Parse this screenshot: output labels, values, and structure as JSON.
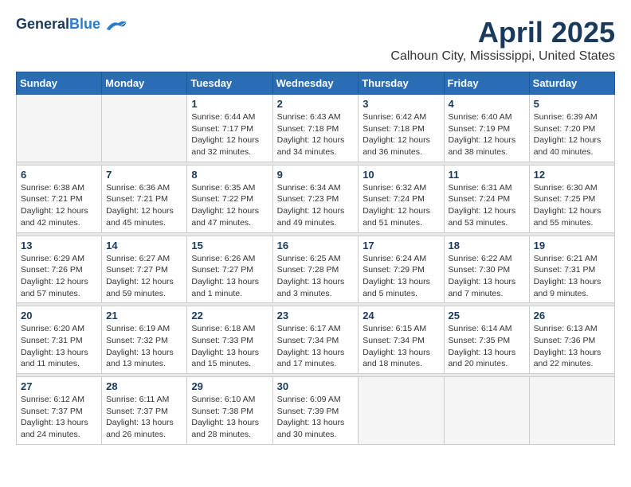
{
  "logo": {
    "general": "General",
    "blue": "Blue"
  },
  "title": "April 2025",
  "subtitle": "Calhoun City, Mississippi, United States",
  "headers": [
    "Sunday",
    "Monday",
    "Tuesday",
    "Wednesday",
    "Thursday",
    "Friday",
    "Saturday"
  ],
  "weeks": [
    [
      {
        "num": "",
        "info": ""
      },
      {
        "num": "",
        "info": ""
      },
      {
        "num": "1",
        "info": "Sunrise: 6:44 AM\nSunset: 7:17 PM\nDaylight: 12 hours\nand 32 minutes."
      },
      {
        "num": "2",
        "info": "Sunrise: 6:43 AM\nSunset: 7:18 PM\nDaylight: 12 hours\nand 34 minutes."
      },
      {
        "num": "3",
        "info": "Sunrise: 6:42 AM\nSunset: 7:18 PM\nDaylight: 12 hours\nand 36 minutes."
      },
      {
        "num": "4",
        "info": "Sunrise: 6:40 AM\nSunset: 7:19 PM\nDaylight: 12 hours\nand 38 minutes."
      },
      {
        "num": "5",
        "info": "Sunrise: 6:39 AM\nSunset: 7:20 PM\nDaylight: 12 hours\nand 40 minutes."
      }
    ],
    [
      {
        "num": "6",
        "info": "Sunrise: 6:38 AM\nSunset: 7:21 PM\nDaylight: 12 hours\nand 42 minutes."
      },
      {
        "num": "7",
        "info": "Sunrise: 6:36 AM\nSunset: 7:21 PM\nDaylight: 12 hours\nand 45 minutes."
      },
      {
        "num": "8",
        "info": "Sunrise: 6:35 AM\nSunset: 7:22 PM\nDaylight: 12 hours\nand 47 minutes."
      },
      {
        "num": "9",
        "info": "Sunrise: 6:34 AM\nSunset: 7:23 PM\nDaylight: 12 hours\nand 49 minutes."
      },
      {
        "num": "10",
        "info": "Sunrise: 6:32 AM\nSunset: 7:24 PM\nDaylight: 12 hours\nand 51 minutes."
      },
      {
        "num": "11",
        "info": "Sunrise: 6:31 AM\nSunset: 7:24 PM\nDaylight: 12 hours\nand 53 minutes."
      },
      {
        "num": "12",
        "info": "Sunrise: 6:30 AM\nSunset: 7:25 PM\nDaylight: 12 hours\nand 55 minutes."
      }
    ],
    [
      {
        "num": "13",
        "info": "Sunrise: 6:29 AM\nSunset: 7:26 PM\nDaylight: 12 hours\nand 57 minutes."
      },
      {
        "num": "14",
        "info": "Sunrise: 6:27 AM\nSunset: 7:27 PM\nDaylight: 12 hours\nand 59 minutes."
      },
      {
        "num": "15",
        "info": "Sunrise: 6:26 AM\nSunset: 7:27 PM\nDaylight: 13 hours\nand 1 minute."
      },
      {
        "num": "16",
        "info": "Sunrise: 6:25 AM\nSunset: 7:28 PM\nDaylight: 13 hours\nand 3 minutes."
      },
      {
        "num": "17",
        "info": "Sunrise: 6:24 AM\nSunset: 7:29 PM\nDaylight: 13 hours\nand 5 minutes."
      },
      {
        "num": "18",
        "info": "Sunrise: 6:22 AM\nSunset: 7:30 PM\nDaylight: 13 hours\nand 7 minutes."
      },
      {
        "num": "19",
        "info": "Sunrise: 6:21 AM\nSunset: 7:31 PM\nDaylight: 13 hours\nand 9 minutes."
      }
    ],
    [
      {
        "num": "20",
        "info": "Sunrise: 6:20 AM\nSunset: 7:31 PM\nDaylight: 13 hours\nand 11 minutes."
      },
      {
        "num": "21",
        "info": "Sunrise: 6:19 AM\nSunset: 7:32 PM\nDaylight: 13 hours\nand 13 minutes."
      },
      {
        "num": "22",
        "info": "Sunrise: 6:18 AM\nSunset: 7:33 PM\nDaylight: 13 hours\nand 15 minutes."
      },
      {
        "num": "23",
        "info": "Sunrise: 6:17 AM\nSunset: 7:34 PM\nDaylight: 13 hours\nand 17 minutes."
      },
      {
        "num": "24",
        "info": "Sunrise: 6:15 AM\nSunset: 7:34 PM\nDaylight: 13 hours\nand 18 minutes."
      },
      {
        "num": "25",
        "info": "Sunrise: 6:14 AM\nSunset: 7:35 PM\nDaylight: 13 hours\nand 20 minutes."
      },
      {
        "num": "26",
        "info": "Sunrise: 6:13 AM\nSunset: 7:36 PM\nDaylight: 13 hours\nand 22 minutes."
      }
    ],
    [
      {
        "num": "27",
        "info": "Sunrise: 6:12 AM\nSunset: 7:37 PM\nDaylight: 13 hours\nand 24 minutes."
      },
      {
        "num": "28",
        "info": "Sunrise: 6:11 AM\nSunset: 7:37 PM\nDaylight: 13 hours\nand 26 minutes."
      },
      {
        "num": "29",
        "info": "Sunrise: 6:10 AM\nSunset: 7:38 PM\nDaylight: 13 hours\nand 28 minutes."
      },
      {
        "num": "30",
        "info": "Sunrise: 6:09 AM\nSunset: 7:39 PM\nDaylight: 13 hours\nand 30 minutes."
      },
      {
        "num": "",
        "info": ""
      },
      {
        "num": "",
        "info": ""
      },
      {
        "num": "",
        "info": ""
      }
    ]
  ]
}
